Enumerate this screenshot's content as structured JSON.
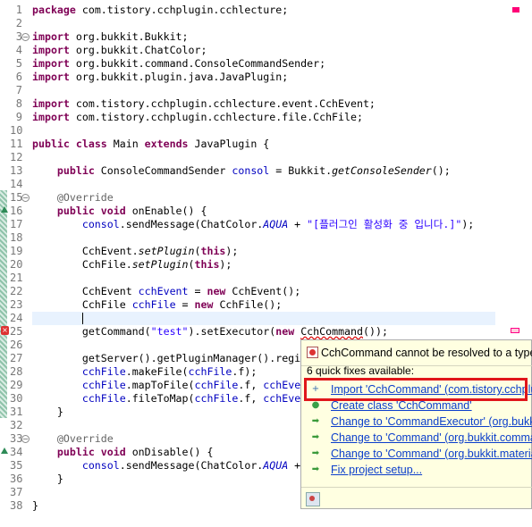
{
  "editor": {
    "lines": [
      {
        "num": "1",
        "parts": [
          {
            "t": "package",
            "c": "kw"
          },
          {
            "t": " com.tistory.cchplugin.cchlecture;"
          }
        ]
      },
      {
        "num": "2",
        "parts": []
      },
      {
        "num": "3",
        "fold": true,
        "parts": [
          {
            "t": "import",
            "c": "kw"
          },
          {
            "t": " org.bukkit.Bukkit;"
          }
        ]
      },
      {
        "num": "4",
        "parts": [
          {
            "t": "import",
            "c": "kw"
          },
          {
            "t": " org.bukkit.ChatColor;"
          }
        ]
      },
      {
        "num": "5",
        "parts": [
          {
            "t": "import",
            "c": "kw"
          },
          {
            "t": " org.bukkit.command.ConsoleCommandSender;"
          }
        ]
      },
      {
        "num": "6",
        "parts": [
          {
            "t": "import",
            "c": "kw"
          },
          {
            "t": " org.bukkit.plugin.java.JavaPlugin;"
          }
        ]
      },
      {
        "num": "7",
        "parts": []
      },
      {
        "num": "8",
        "parts": [
          {
            "t": "import",
            "c": "kw"
          },
          {
            "t": " com.tistory.cchplugin.cchlecture.event.CchEvent;"
          }
        ]
      },
      {
        "num": "9",
        "parts": [
          {
            "t": "import",
            "c": "kw"
          },
          {
            "t": " com.tistory.cchplugin.cchlecture.file.CchFile;"
          }
        ]
      },
      {
        "num": "10",
        "parts": []
      },
      {
        "num": "11",
        "parts": [
          {
            "t": "public",
            "c": "kw"
          },
          {
            "t": " "
          },
          {
            "t": "class",
            "c": "kw"
          },
          {
            "t": " Main "
          },
          {
            "t": "extends",
            "c": "kw"
          },
          {
            "t": " JavaPlugin {"
          }
        ]
      },
      {
        "num": "12",
        "parts": []
      },
      {
        "num": "13",
        "parts": [
          {
            "t": "    "
          },
          {
            "t": "public",
            "c": "kw"
          },
          {
            "t": " ConsoleCommandSender "
          },
          {
            "t": "consol",
            "c": "field"
          },
          {
            "t": " = Bukkit."
          },
          {
            "t": "getConsoleSender",
            "c": "ital"
          },
          {
            "t": "();"
          }
        ]
      },
      {
        "num": "14",
        "parts": []
      },
      {
        "num": "15",
        "fold": true,
        "parts": [
          {
            "t": "    "
          },
          {
            "t": "@Override",
            "c": "ann"
          }
        ]
      },
      {
        "num": "16",
        "marker": "green",
        "parts": [
          {
            "t": "    "
          },
          {
            "t": "public",
            "c": "kw"
          },
          {
            "t": " "
          },
          {
            "t": "void",
            "c": "kw"
          },
          {
            "t": " onEnable() {"
          }
        ]
      },
      {
        "num": "17",
        "parts": [
          {
            "t": "        "
          },
          {
            "t": "consol",
            "c": "field"
          },
          {
            "t": ".sendMessage(ChatColor."
          },
          {
            "t": "AQUA",
            "c": "static"
          },
          {
            "t": " + "
          },
          {
            "t": "\"[플러그인 활성화 중 입니다.]\"",
            "c": "str"
          },
          {
            "t": ");"
          }
        ]
      },
      {
        "num": "18",
        "parts": []
      },
      {
        "num": "19",
        "parts": [
          {
            "t": "        CchEvent."
          },
          {
            "t": "setPlugin",
            "c": "ital"
          },
          {
            "t": "("
          },
          {
            "t": "this",
            "c": "kw"
          },
          {
            "t": ");"
          }
        ]
      },
      {
        "num": "20",
        "parts": [
          {
            "t": "        CchFile."
          },
          {
            "t": "setPlugin",
            "c": "ital"
          },
          {
            "t": "("
          },
          {
            "t": "this",
            "c": "kw"
          },
          {
            "t": ");"
          }
        ]
      },
      {
        "num": "21",
        "parts": []
      },
      {
        "num": "22",
        "parts": [
          {
            "t": "        CchEvent "
          },
          {
            "t": "cchEvent",
            "c": "field"
          },
          {
            "t": " = "
          },
          {
            "t": "new",
            "c": "kw"
          },
          {
            "t": " CchEvent();"
          }
        ]
      },
      {
        "num": "23",
        "parts": [
          {
            "t": "        CchFile "
          },
          {
            "t": "cchFile",
            "c": "field"
          },
          {
            "t": " = "
          },
          {
            "t": "new",
            "c": "kw"
          },
          {
            "t": " CchFile();"
          }
        ]
      },
      {
        "num": "24",
        "current": true,
        "caret": true,
        "parts": [
          {
            "t": "        "
          }
        ]
      },
      {
        "num": "25",
        "marker": "error",
        "parts": [
          {
            "t": "        getCommand("
          },
          {
            "t": "\"test\"",
            "c": "str"
          },
          {
            "t": ").setExecutor("
          },
          {
            "t": "new",
            "c": "kw"
          },
          {
            "t": " "
          },
          {
            "t": "CchCommand",
            "c": "errword"
          },
          {
            "t": "());"
          }
        ]
      },
      {
        "num": "26",
        "parts": []
      },
      {
        "num": "27",
        "parts": [
          {
            "t": "        getServer().getPluginManager().regi"
          }
        ]
      },
      {
        "num": "28",
        "parts": [
          {
            "t": "        "
          },
          {
            "t": "cchFile",
            "c": "field"
          },
          {
            "t": ".makeFile("
          },
          {
            "t": "cchFile",
            "c": "field"
          },
          {
            "t": ".f);"
          }
        ]
      },
      {
        "num": "29",
        "parts": [
          {
            "t": "        "
          },
          {
            "t": "cchFile",
            "c": "field"
          },
          {
            "t": ".mapToFile("
          },
          {
            "t": "cchFile",
            "c": "field"
          },
          {
            "t": ".f, "
          },
          {
            "t": "cchEve",
            "c": "field"
          }
        ]
      },
      {
        "num": "30",
        "parts": [
          {
            "t": "        "
          },
          {
            "t": "cchFile",
            "c": "field"
          },
          {
            "t": ".fileToMap("
          },
          {
            "t": "cchFile",
            "c": "field"
          },
          {
            "t": ".f, "
          },
          {
            "t": "cchEve",
            "c": "field"
          }
        ]
      },
      {
        "num": "31",
        "parts": [
          {
            "t": "    }"
          }
        ]
      },
      {
        "num": "32",
        "parts": []
      },
      {
        "num": "33",
        "fold": true,
        "parts": [
          {
            "t": "    "
          },
          {
            "t": "@Override",
            "c": "ann"
          }
        ]
      },
      {
        "num": "34",
        "marker": "green",
        "parts": [
          {
            "t": "    "
          },
          {
            "t": "public",
            "c": "kw"
          },
          {
            "t": " "
          },
          {
            "t": "void",
            "c": "kw"
          },
          {
            "t": " onDisable() {"
          }
        ]
      },
      {
        "num": "35",
        "parts": [
          {
            "t": "        "
          },
          {
            "t": "consol",
            "c": "field"
          },
          {
            "t": ".sendMessage(ChatColor."
          },
          {
            "t": "AQUA",
            "c": "static"
          },
          {
            "t": " +"
          }
        ]
      },
      {
        "num": "36",
        "parts": [
          {
            "t": "    }"
          }
        ]
      },
      {
        "num": "37",
        "parts": []
      },
      {
        "num": "38",
        "parts": [
          {
            "t": "}"
          }
        ]
      }
    ]
  },
  "quickfix": {
    "title": "CchCommand cannot be resolved to a type",
    "count_label": "6 quick fixes available:",
    "items": [
      {
        "label": "Import 'CchCommand' (com.tistory.cchplugin.cchlecture)",
        "icon": "import-icon",
        "glyph": "+",
        "color": "#3a6fb0"
      },
      {
        "label": "Create class 'CchCommand'",
        "icon": "create-class-icon",
        "glyph": "●",
        "color": "#3aa04a"
      },
      {
        "label": "Change to 'CommandExecutor' (org.bukkit.command)",
        "icon": "change-to-icon",
        "glyph": "➡",
        "color": "#3a9a3a"
      },
      {
        "label": "Change to 'Command' (org.bukkit.command)",
        "icon": "change-to-icon",
        "glyph": "➡",
        "color": "#3a9a3a"
      },
      {
        "label": "Change to 'Command' (org.bukkit.material)",
        "icon": "change-to-icon",
        "glyph": "➡",
        "color": "#3a9a3a"
      },
      {
        "label": "Fix project setup...",
        "icon": "fix-setup-icon",
        "glyph": "➡",
        "color": "#3a9a3a"
      }
    ]
  },
  "colors": {
    "keyword": "#7f0055",
    "field": "#0000c0",
    "string": "#2a00ff",
    "annotation": "#646464",
    "link": "#0b3ecb",
    "highlight_box": "#e0161b",
    "popup_bg": "#ffffe1"
  }
}
